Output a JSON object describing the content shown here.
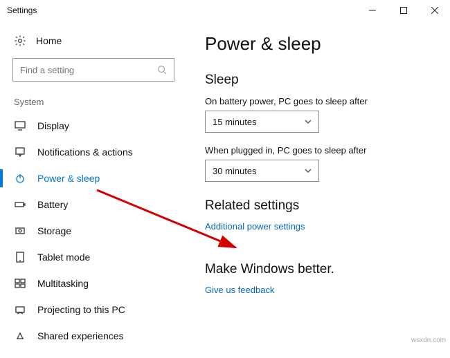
{
  "window": {
    "title": "Settings"
  },
  "home": {
    "label": "Home"
  },
  "search": {
    "placeholder": "Find a setting"
  },
  "group": "System",
  "nav": [
    {
      "label": "Display"
    },
    {
      "label": "Notifications & actions"
    },
    {
      "label": "Power & sleep"
    },
    {
      "label": "Battery"
    },
    {
      "label": "Storage"
    },
    {
      "label": "Tablet mode"
    },
    {
      "label": "Multitasking"
    },
    {
      "label": "Projecting to this PC"
    },
    {
      "label": "Shared experiences"
    }
  ],
  "main": {
    "title": "Power & sleep",
    "sleep_h": "Sleep",
    "battery_label": "On battery power, PC goes to sleep after",
    "battery_value": "15 minutes",
    "plugged_label": "When plugged in, PC goes to sleep after",
    "plugged_value": "30 minutes",
    "related_h": "Related settings",
    "related_link": "Additional power settings",
    "better_h": "Make Windows better.",
    "feedback_link": "Give us feedback"
  },
  "watermark": "wsxdn.com"
}
